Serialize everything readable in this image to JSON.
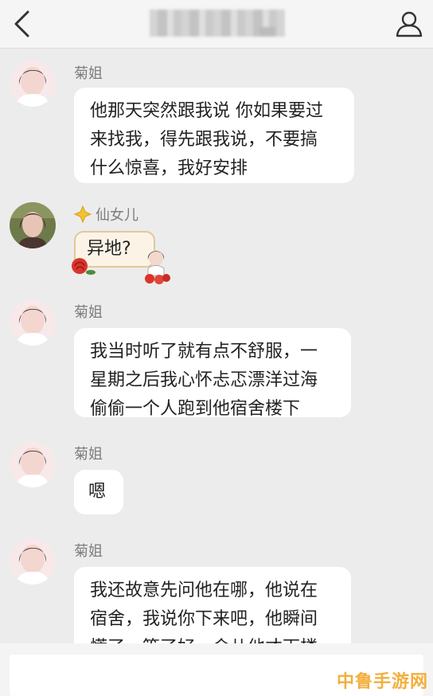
{
  "app": {
    "title_obscured": true
  },
  "colors": {
    "background": "#ececec",
    "bubble": "#ffffff",
    "sender_name": "#7d7d7d",
    "badge_gold": "#f1c232",
    "watermark": "#f2a21b"
  },
  "icons": {
    "back": "chevron-left-icon",
    "profile": "person-icon",
    "badge": "diamond-sparkle-icon"
  },
  "messages": [
    {
      "sender": "菊姐",
      "text": "他那天突然跟我说 你如果要过\n来找我，得先跟我说，不要搞\n什么惊喜，我好安排"
    },
    {
      "sender": "仙女儿",
      "text": "异地?"
    },
    {
      "sender": "菊姐",
      "text": "我当时听了就有点不舒服，一\n星期之后我心怀忐忑漂洋过海\n偷偷一个人跑到他宿舍楼下"
    },
    {
      "sender": "菊姐",
      "text": "嗯"
    },
    {
      "sender": "菊姐",
      "text": "我还故意先问他在哪，他说在\n宿舍，我说你下来吧，他瞬间\n慌了，等了好一会儿他才下楼"
    }
  ],
  "watermark": {
    "text": "中鲁手游网"
  }
}
